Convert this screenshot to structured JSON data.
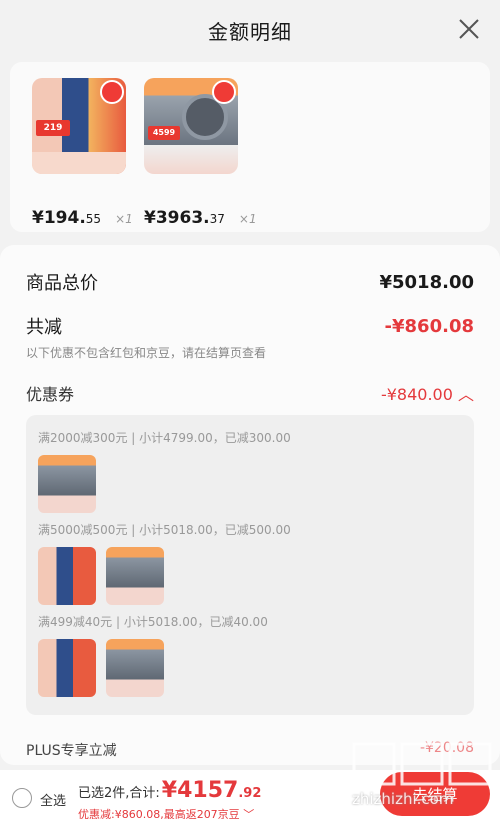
{
  "header": {
    "title": "金额明细"
  },
  "products": [
    {
      "price": "¥194.",
      "price_decimal": "55",
      "qty": "×1",
      "image_label": "219"
    },
    {
      "price": "¥3963.",
      "price_decimal": "37",
      "qty": "×1",
      "image_label": "4599"
    }
  ],
  "summary": {
    "total_label": "商品总价",
    "total_value": "¥5018.00",
    "discount_label": "共减",
    "discount_value": "-¥860.08",
    "note": "以下优惠不包含红包和京豆，请在结算页查看"
  },
  "coupon": {
    "label": "优惠券",
    "value": "-¥840.00",
    "groups": [
      {
        "title": "满2000减300元 | 小计4799.00，已减300.00"
      },
      {
        "title": "满5000减500元 | 小计5018.00，已减500.00"
      },
      {
        "title": "满499减40元 | 小计5018.00，已减40.00"
      }
    ]
  },
  "plus": {
    "label": "PLUS专享立减",
    "value": "-¥20.08"
  },
  "bottom": {
    "select_all": "全选",
    "selected_prefix": "已选2件,合计:",
    "total": "¥4157",
    "total_decimal": ".92",
    "discount_line": "优惠减:¥860.08,最高返207京豆",
    "checkout": "去结算"
  },
  "watermark": {
    "text": "zhizhizhi.com"
  },
  "colors": {
    "accent": "#e4393c",
    "background": "#f2f2f2"
  }
}
